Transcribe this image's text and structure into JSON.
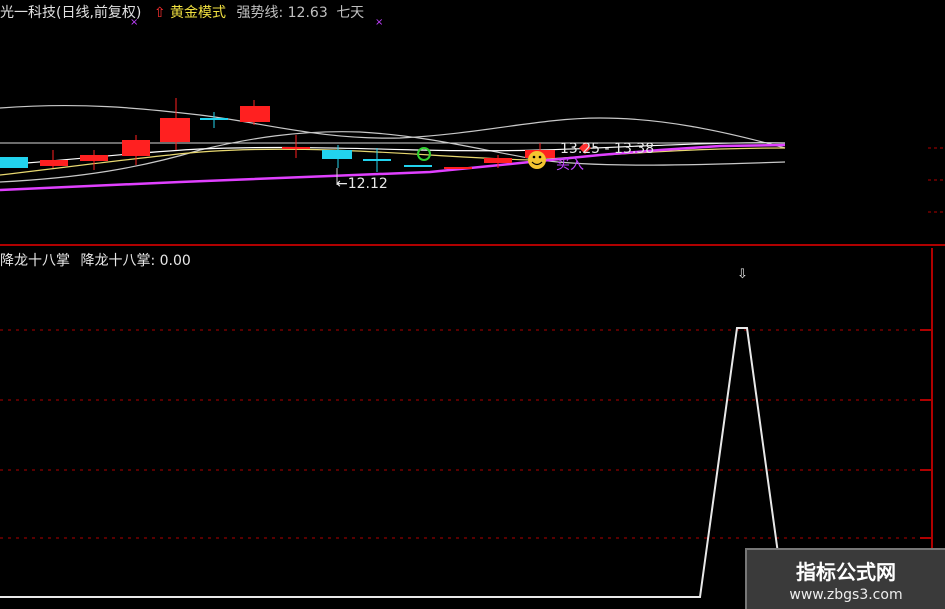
{
  "header": {
    "stock_title": "光一科技(日线,前复权)",
    "mode_arrow_glyph": "⇧",
    "mode_label": "黄金模式",
    "strong_line_label": "强势线:",
    "strong_line_value": "12.63",
    "trailing_text": "七天"
  },
  "top_panel": {
    "low_annotation": "←12.12",
    "high_annotation": "13.25 - 13.38",
    "buy_label": "买入"
  },
  "indicator": {
    "name": "降龙十八掌",
    "value_label": "降龙十八掌:",
    "value": "0.00",
    "marker_glyph": "⇩"
  },
  "watermark": {
    "title": "指标公式网",
    "url": "www.zbgs3.com"
  },
  "colors": {
    "background": "#000000",
    "up_candle": "#ff2020",
    "down_candle": "#22d3ee",
    "strong_line": "#e040ff",
    "divider": "#b00000",
    "indicator_line": "#e8e8e8"
  }
}
